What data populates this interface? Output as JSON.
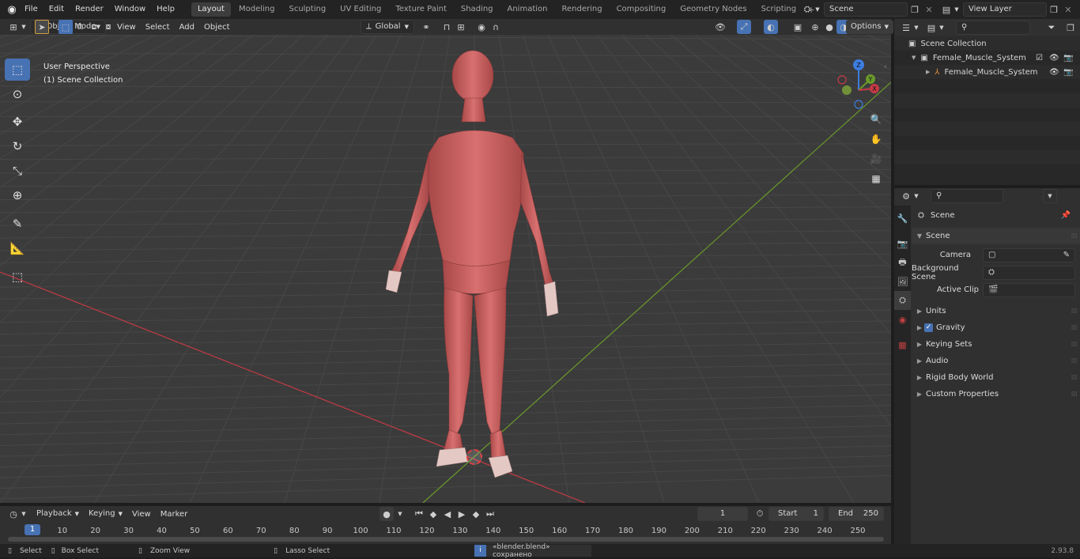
{
  "menu": [
    "File",
    "Edit",
    "Render",
    "Window",
    "Help"
  ],
  "workspaces": [
    "Layout",
    "Modeling",
    "Sculpting",
    "UV Editing",
    "Texture Paint",
    "Shading",
    "Animation",
    "Rendering",
    "Compositing",
    "Geometry Nodes",
    "Scripting"
  ],
  "active_workspace": "Layout",
  "scene_name": "Scene",
  "view_layer": "View Layer",
  "viewport": {
    "mode": "Object Mode",
    "menus": [
      "View",
      "Select",
      "Add",
      "Object"
    ],
    "orientation": "Global",
    "options_label": "Options",
    "overlay_line1": "User Perspective",
    "overlay_line2": "(1) Scene Collection",
    "gizmo_labels": {
      "z": "Z",
      "y": "Y",
      "x": "X"
    }
  },
  "outliner": {
    "root": "Scene Collection",
    "collection": "Female_Muscle_System",
    "object": "Female_Muscle_System"
  },
  "properties": {
    "context": "Scene",
    "panel_title": "Scene",
    "camera_label": "Camera",
    "background_scene_label": "Background Scene",
    "active_clip_label": "Active Clip",
    "subpanels": [
      "Units",
      "Gravity",
      "Keying Sets",
      "Audio",
      "Rigid Body World",
      "Custom Properties"
    ]
  },
  "timeline": {
    "menus": [
      "Playback",
      "Keying",
      "View",
      "Marker"
    ],
    "current_frame": "1",
    "start_label": "Start",
    "start_value": "1",
    "end_label": "End",
    "end_value": "250",
    "ticks": [
      "1",
      "10",
      "20",
      "30",
      "40",
      "50",
      "60",
      "70",
      "80",
      "90",
      "100",
      "110",
      "120",
      "130",
      "140",
      "150",
      "160",
      "170",
      "180",
      "190",
      "200",
      "210",
      "220",
      "230",
      "240",
      "250"
    ]
  },
  "statusbar": {
    "select": "Select",
    "box_select": "Box Select",
    "zoom_view": "Zoom View",
    "lasso_select": "Lasso Select",
    "message": "«blender.blend» сохранено",
    "version": "2.93.8"
  },
  "colors": {
    "accent": "#4772b3",
    "x_axis": "#c63a45",
    "y_axis": "#6a9a2a",
    "z_axis": "#3d7de0",
    "muscle": "#c8605e"
  }
}
